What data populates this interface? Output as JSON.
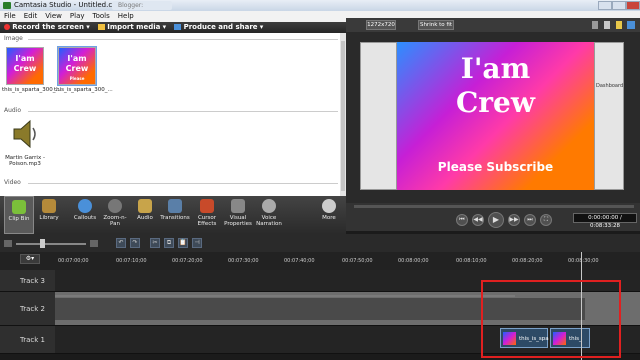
{
  "window": {
    "title": "Camtasia Studio - Untitled.camproj",
    "ghost_tab": "Blogger: Dashboard"
  },
  "menu": [
    "File",
    "Edit",
    "View",
    "Play",
    "Tools",
    "Help"
  ],
  "toolbar": {
    "record": "Record the screen",
    "import": "Import media",
    "produce": "Produce and share"
  },
  "clipbin": {
    "image_label": "Image",
    "audio_label": "Audio",
    "video_label": "Video",
    "images": [
      {
        "caption": "this_is_sparta_300_...",
        "line1": "I'am",
        "line2": "Crew"
      },
      {
        "caption": "this_is_sparta_300_...",
        "line1": "I'am",
        "line2": "Crew",
        "line3": "Please Subscribe"
      }
    ],
    "audio": {
      "caption": "Martin Garrix - Poison.mp3"
    }
  },
  "preview": {
    "resolution": "1272x720",
    "zoom": "Shrink to fit",
    "line1": "I'am",
    "line2": "Crew",
    "line3": "Please Subscribe",
    "ghost_title": "Dashboard"
  },
  "player": {
    "time": "0:00:00:00 / 0:08:33:28"
  },
  "tasks": [
    {
      "label": "Clip Bin",
      "icon": "clip-bin-icon",
      "color": "#7bbf3a"
    },
    {
      "label": "Library",
      "icon": "library-icon",
      "color": "#b58a3a"
    },
    {
      "label": "Callouts",
      "icon": "callouts-icon",
      "color": "#4a90d9"
    },
    {
      "label": "Zoom-n-Pan",
      "icon": "zoom-icon",
      "color": "#777777"
    },
    {
      "label": "Audio",
      "icon": "audio-icon",
      "color": "#c8a44a"
    },
    {
      "label": "Transitions",
      "icon": "transitions-icon",
      "color": "#5a7fa8"
    },
    {
      "label": "Cursor Effects",
      "icon": "cursor-icon",
      "color": "#c84a2a"
    },
    {
      "label": "Visual Properties",
      "icon": "visual-properties-icon",
      "color": "#888888"
    },
    {
      "label": "Voice Narration",
      "icon": "microphone-icon",
      "color": "#aaaaaa"
    },
    {
      "label": "More",
      "icon": "more-icon",
      "color": "#cccccc"
    }
  ],
  "ruler_ticks": [
    "00:07:00;00",
    "00:07:10;00",
    "00:07:20;00",
    "00:07:30;00",
    "00:07:40;00",
    "00:07:50;00",
    "00:08:00;00",
    "00:08:10;00",
    "00:08:20;00",
    "00:08:30;00"
  ],
  "tracks": {
    "track3": "Track 3",
    "track2": "Track 2",
    "track1": "Track 1"
  },
  "clips": [
    {
      "label": "this_is_spa"
    },
    {
      "label": "this_"
    }
  ]
}
